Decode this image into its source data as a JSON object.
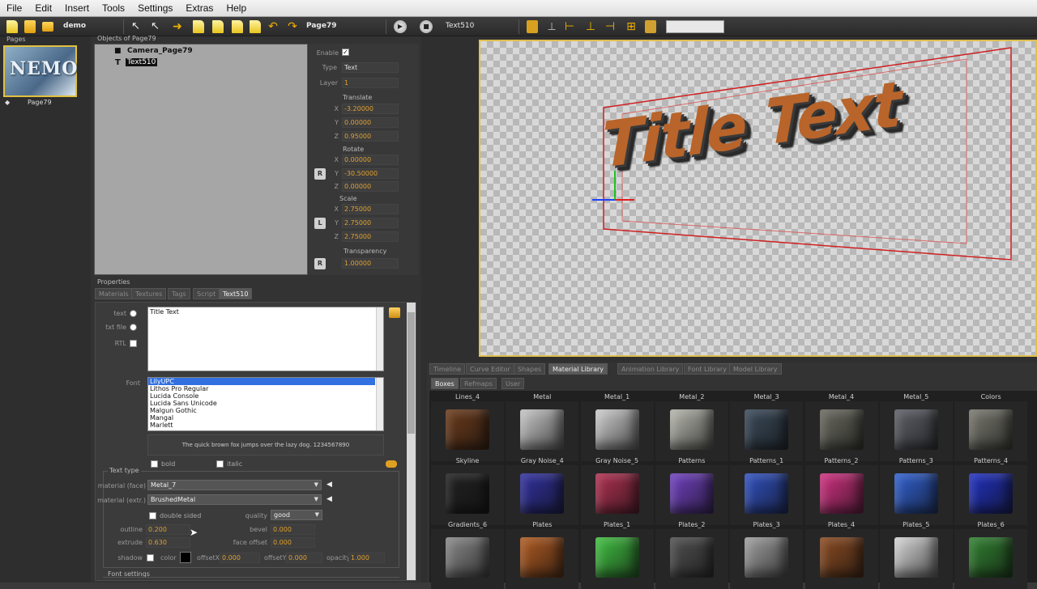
{
  "menu": [
    "File",
    "Edit",
    "Insert",
    "Tools",
    "Settings",
    "Extras",
    "Help"
  ],
  "toolbar": {
    "project": "demo",
    "page": "Page79",
    "object": "Text510"
  },
  "pages_panel": {
    "caption": "Pages",
    "thumb_logo": "NEMO",
    "page_label": "Page79"
  },
  "objects_panel": {
    "caption": "Objects of Page79",
    "items": [
      "Camera_Page79",
      "Text510"
    ]
  },
  "transform": {
    "enable_label": "Enable",
    "type_label": "Type",
    "type_value": "Text",
    "layer_label": "Layer",
    "layer_value": "1",
    "translate_label": "Translate",
    "translate": {
      "x": "-3.20000",
      "y": "0.00000",
      "z": "0.95000"
    },
    "rotate_label": "Rotate",
    "rotate": {
      "x": "0.00000",
      "y": "-30.50000",
      "z": "0.00000"
    },
    "scale_label": "Scale",
    "scale": {
      "x": "2.75000",
      "y": "2.75000",
      "z": "2.75000"
    },
    "transparency_label": "Transparency",
    "transparency": "1.00000",
    "btn_r": "R",
    "btn_l": "L"
  },
  "properties": {
    "caption": "Properties",
    "tabs": [
      "Materials",
      "Textures",
      "Tags",
      "Script",
      "Text510"
    ],
    "text_label": "text",
    "txtfile_label": "txt file",
    "rtl_label": "RTL",
    "text_value": "Title Text",
    "font_label": "Font",
    "fonts": [
      "LilyUPC",
      "Lithos Pro Regular",
      "Lucida Console",
      "Lucida Sans Unicode",
      "Malgun Gothic",
      "Mangal",
      "Marlett"
    ],
    "preview": "The quick brown fox jumps over the lazy dog. 1234567890",
    "bold_label": "bold",
    "italic_label": "italic",
    "text_type_caption": "Text type",
    "material_face_label": "material (face)",
    "material_face": "Metal_7",
    "material_extr_label": "material (extr.)",
    "material_extr": "BrushedMetal",
    "double_sided_label": "double sided",
    "quality_label": "quality",
    "quality": "good",
    "outline_label": "outline",
    "outline": "0.200",
    "bevel_label": "bevel",
    "bevel": "0.000",
    "extrude_label": "extrude",
    "extrude": "0.630",
    "face_offset_label": "face offset",
    "face_offset": "0.000",
    "shadow_label": "shadow",
    "color_label": "color",
    "offsetx_label": "offsetX",
    "offsetx": "0.000",
    "offsety_label": "offsetY",
    "offsety": "0.000",
    "opacity_label": "opacity",
    "opacity": "1.000",
    "font_settings_caption": "Font settings"
  },
  "viewport": {
    "title_text": "Title Text"
  },
  "library": {
    "tabs": [
      "Timeline",
      "Curve Editor",
      "Shapes",
      "Material Library",
      "Animation Library",
      "Font Library",
      "Model Library"
    ],
    "subtabs": [
      "Boxes",
      "Refmaps",
      "User"
    ],
    "row1": [
      "Lines_4",
      "Metal",
      "Metal_1",
      "Metal_2",
      "Metal_3",
      "Metal_4",
      "Metal_5",
      "Colors"
    ],
    "row2": [
      "Skyline",
      "Gray Noise_4",
      "Gray Noise_5",
      "Patterns",
      "Patterns_1",
      "Patterns_2",
      "Patterns_3",
      "Patterns_4"
    ],
    "row3": [
      "Gradients_6",
      "Plates",
      "Plates_1",
      "Plates_2",
      "Plates_3",
      "Plates_4",
      "Plates_5",
      "Plates_6"
    ],
    "colors": {
      "row1": [
        "#6b3a1a",
        "#c9c9c9",
        "#d0d0d0",
        "#b8b8b0",
        "#3a4a5a",
        "#6a6a60",
        "#5e6068",
        "#7a7a70"
      ],
      "row2": [
        "#202020",
        "#3030a0",
        "#b03050",
        "#7040c0",
        "#3050c0",
        "#d03080",
        "#3060d0",
        "#2030c0"
      ],
      "row3": [
        "#8a8a8a",
        "#b05a20",
        "#40c040",
        "#505050",
        "#a0a0a0",
        "#8a4a20",
        "#d8d8d8",
        "#308030"
      ]
    }
  }
}
